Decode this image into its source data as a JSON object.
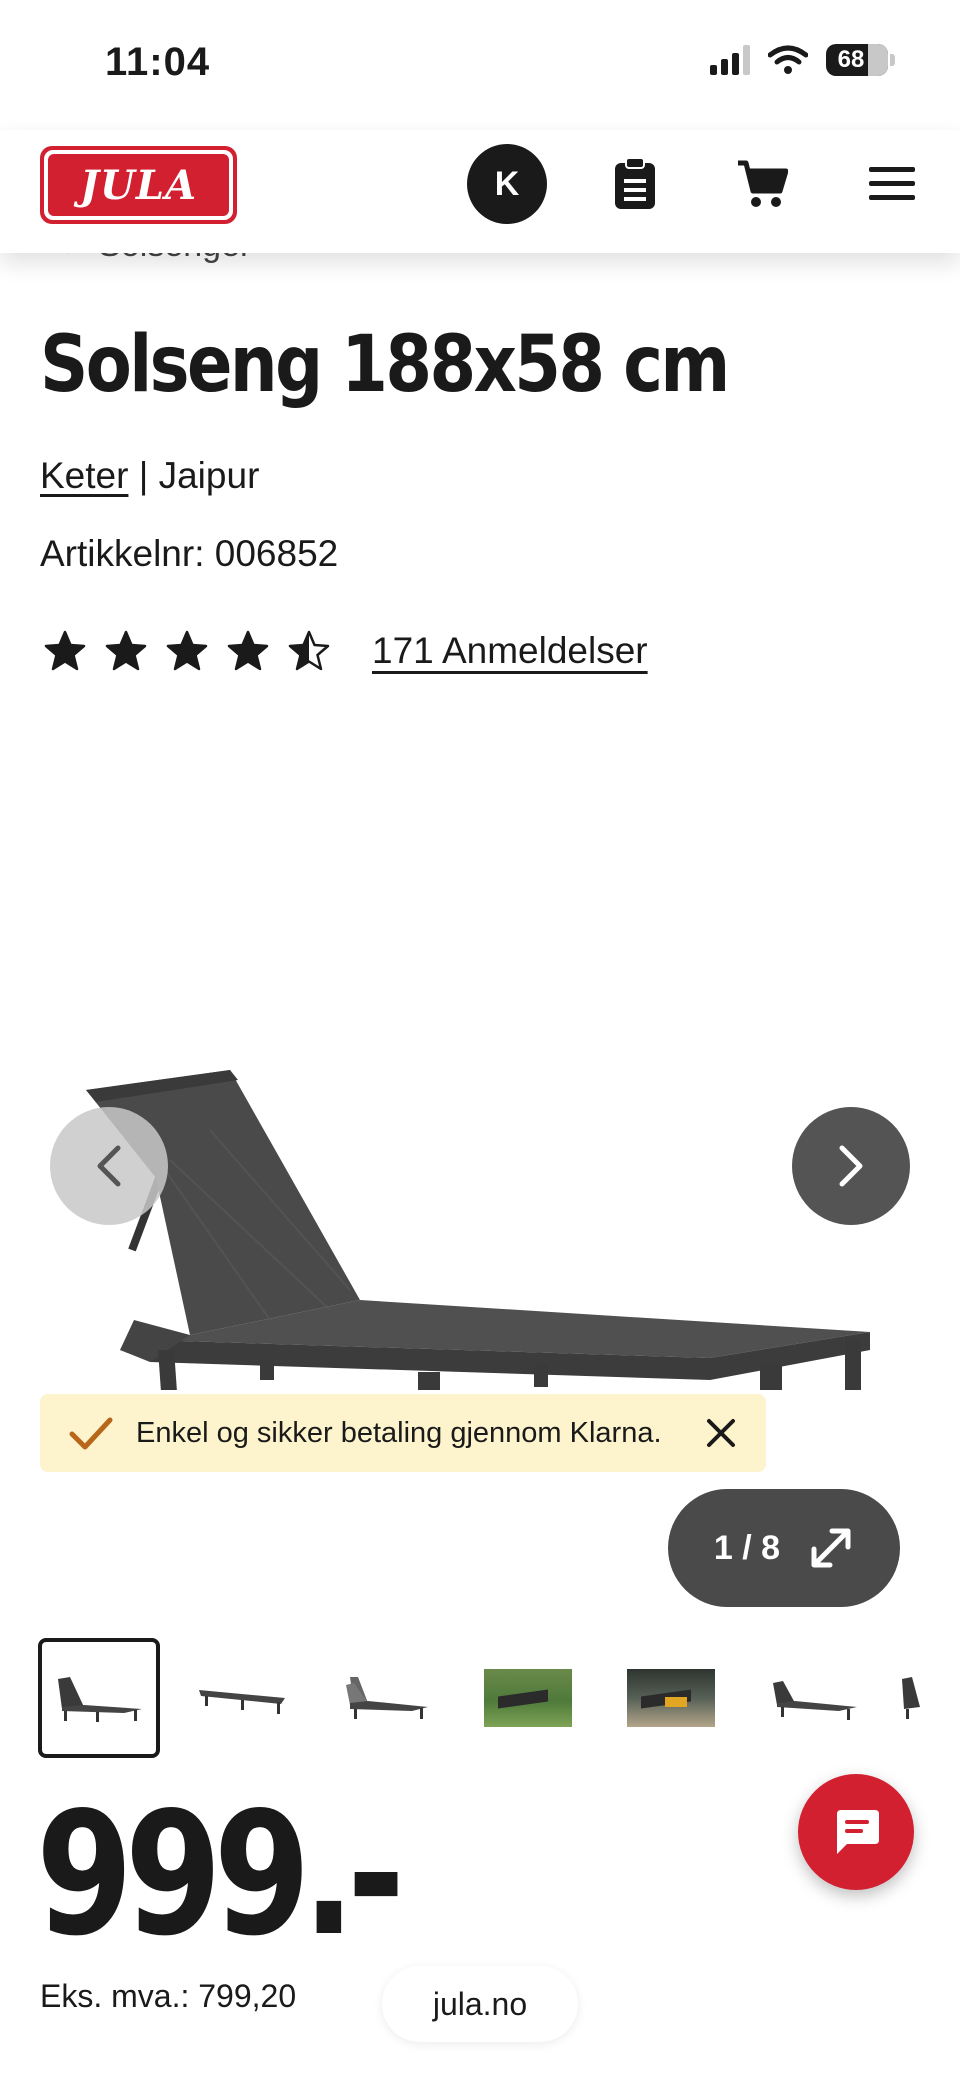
{
  "status_bar": {
    "time": "11:04",
    "battery": "68"
  },
  "header": {
    "logo_text": "JULA",
    "avatar_initial": "K",
    "icons": [
      "clipboard-icon",
      "cart-icon",
      "menu-icon"
    ]
  },
  "breadcrumb": {
    "label": "Solsenger"
  },
  "product": {
    "title": "Solseng 188x58 cm",
    "brand": "Keter",
    "separator": " | ",
    "series": "Jaipur",
    "sku_label": "Artikkelnr: 006852",
    "rating": 4.5,
    "rating_max": 5,
    "reviews_label": "171 Anmeldelser"
  },
  "gallery": {
    "banner_text": "Enkel og sikker betaling gjennom Klarna.",
    "counter": "1 / 8",
    "thumbnails": [
      "lounger",
      "lounger-flat",
      "lounger-positions",
      "garden-photo",
      "patio-photo",
      "lounger-side",
      "lounger-partial"
    ]
  },
  "price": {
    "amount": "999.-",
    "vat_label": "Eks. mva.: 799,20"
  },
  "footer": {
    "url": "jula.no"
  },
  "colors": {
    "brand_red": "#d32030",
    "banner_bg": "#fdf3cc",
    "dark": "#1a1a1a",
    "check": "#b8661a"
  }
}
